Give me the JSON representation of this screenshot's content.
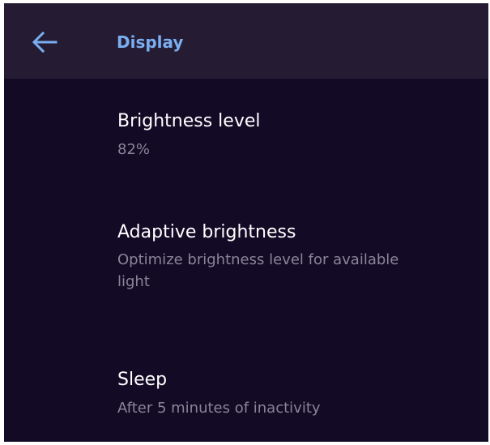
{
  "app_bar": {
    "back_icon": "arrow-left-icon",
    "title": "Display"
  },
  "settings": [
    {
      "title": "Brightness level",
      "summary": "82%"
    },
    {
      "title": "Adaptive brightness",
      "summary": "Optimize brightness level for available light"
    },
    {
      "title": "Sleep",
      "summary": "After 5 minutes of inactivity"
    }
  ],
  "colors": {
    "background": "#130a26",
    "app_bar_background": "#251c34",
    "accent": "#7aaef0",
    "title_text": "#ffffff",
    "summary_text": "#8a8498"
  }
}
